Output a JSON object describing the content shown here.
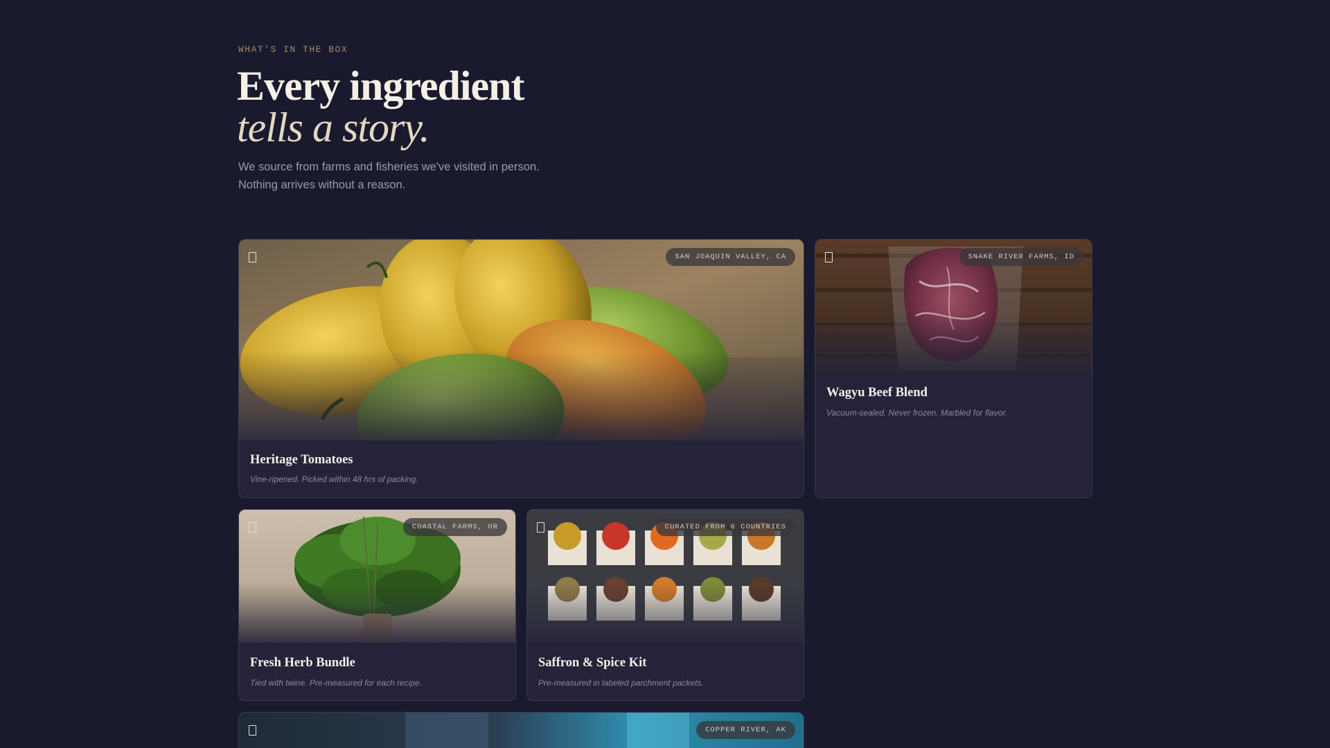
{
  "header": {
    "eyebrow": "WHAT'S IN THE BOX",
    "title_line1": "Every ingredient",
    "title_line2": "tells a story.",
    "intro_line1": "We source from farms and fisheries we've visited in person.",
    "intro_line2": "Nothing arrives without a reason."
  },
  "cards": [
    {
      "title": "Heritage Tomatoes",
      "description": "Vine-ripened. Picked within 48 hrs of packing.",
      "origin": "SAN JOAQUIN VALLEY, CA",
      "icon": "bookmark-icon"
    },
    {
      "title": "Wagyu Beef Blend",
      "description": "Vacuum-sealed. Never frozen. Marbled for flavor.",
      "origin": "SNAKE RIVER FARMS, ID",
      "icon": "bookmark-icon"
    },
    {
      "title": "Fresh Herb Bundle",
      "description": "Tied with twine. Pre-measured for each recipe.",
      "origin": "COASTAL FARMS, OR",
      "icon": "bookmark-icon"
    },
    {
      "title": "Saffron & Spice Kit",
      "description": "Pre-measured in labeled parchment packets.",
      "origin": "CURATED FROM 6 COUNTRIES",
      "icon": "bookmark-icon"
    },
    {
      "title": "",
      "description": "",
      "origin": "COPPER RIVER, AK",
      "icon": "bookmark-icon"
    }
  ],
  "colors": {
    "background": "#1a1a2e",
    "card": "#24233a",
    "accent": "#a88c62",
    "heading": "#f5efe6",
    "muted": "#8e8b98"
  }
}
